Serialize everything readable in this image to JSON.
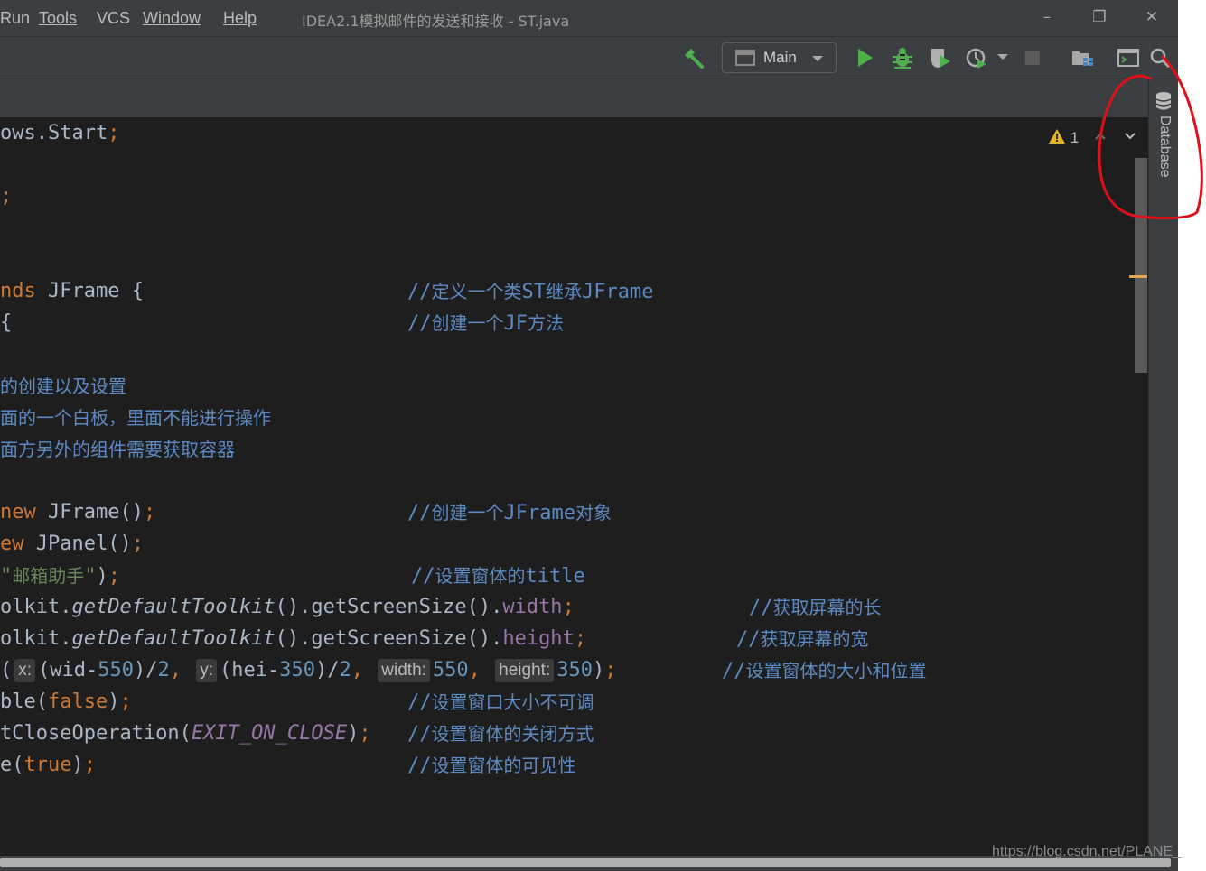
{
  "menubar": {
    "items": [
      "Run",
      "Tools",
      "VCS",
      "Window",
      "Help"
    ],
    "window_title": "IDEA2.1模拟邮件的发送和接收 - ST.java"
  },
  "toolbar": {
    "run_config": "Main"
  },
  "editor": {
    "lines": [
      {
        "code": "ows.Start;"
      },
      {
        "code": ";"
      },
      {
        "code": "nds JFrame {",
        "comment": "//定义一个类ST继承JFrame"
      },
      {
        "code": "{",
        "comment": "//创建一个JF方法"
      },
      {
        "comment": "的创建以及设置"
      },
      {
        "comment": "面的一个白板，里面不能进行操作"
      },
      {
        "comment": "面方另外的组件需要获取容器"
      },
      {
        "code": "new JFrame();",
        "comment": "//创建一个JFrame对象"
      },
      {
        "code": "ew JPanel();"
      },
      {
        "code": "\"邮箱助手\");",
        "comment": "//设置窗体的title"
      },
      {
        "code": "olkit.getDefaultToolkit().getScreenSize().width;",
        "comment": "//获取屏幕的长"
      },
      {
        "code": "olkit.getDefaultToolkit().getScreenSize().height;",
        "comment": "//获取屏幕的宽"
      },
      {
        "code": "(x:(wid-550)/2, y:(hei-350)/2, width:550, height:350);",
        "comment": "//设置窗体的大小和位置"
      },
      {
        "code": "ble(false);",
        "comment": "//设置窗口大小不可调"
      },
      {
        "code": "tCloseOperation(EXIT_ON_CLOSE);",
        "comment": "//设置窗体的关闭方式"
      },
      {
        "code": "e(true);",
        "comment": "//设置窗体的可见性"
      }
    ],
    "inlay_hints": [
      "x:",
      "y:",
      "width:",
      "height:"
    ],
    "warning_count": "1"
  },
  "side_panel": {
    "database_label": "Database"
  },
  "watermark": "https://blog.csdn.net/PLANE_",
  "colors": {
    "keyword": "#cc7832",
    "number": "#6897bb",
    "string": "#6a8759",
    "field": "#9876aa",
    "comment": "#5c8ac4",
    "annotation_circle": "#e0101a"
  },
  "icons": [
    "build-hammer-icon",
    "run-config-icon",
    "dropdown-arrow-icon",
    "run-icon",
    "debug-icon",
    "coverage-icon",
    "profiler-icon",
    "stop-icon",
    "project-structure-icon",
    "terminal-icon",
    "search-icon",
    "warning-icon",
    "database-icon"
  ]
}
